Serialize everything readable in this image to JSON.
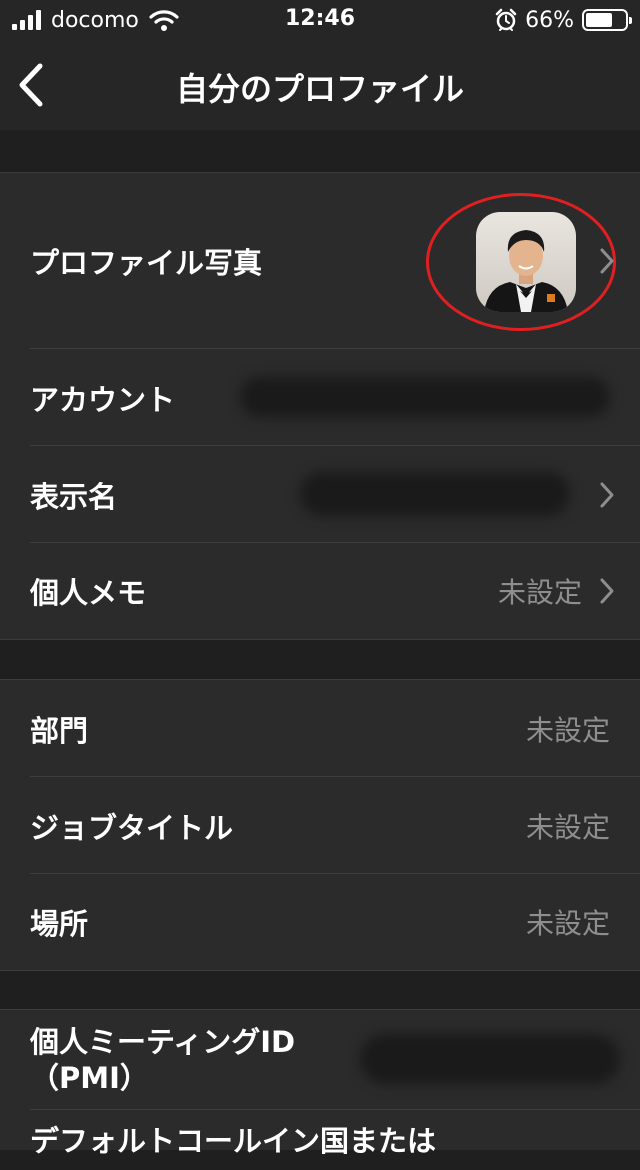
{
  "status_bar": {
    "carrier": "docomo",
    "time": "12:46",
    "battery_percent": "66%",
    "battery_level": 0.66,
    "icons": [
      "signal-icon",
      "wifi-icon",
      "alarm-icon",
      "battery-icon"
    ]
  },
  "header": {
    "title": "自分のプロファイル",
    "back_icon": "chevron-left-icon"
  },
  "sections": {
    "profile": {
      "photo_label": "プロファイル写真",
      "account_label": "アカウント",
      "display_name_label": "表示名",
      "memo_label": "個人メモ",
      "memo_value": "未設定"
    },
    "work": {
      "department_label": "部門",
      "department_value": "未設定",
      "job_title_label": "ジョブタイトル",
      "job_title_value": "未設定",
      "location_label": "場所",
      "location_value": "未設定"
    },
    "meeting": {
      "pmi_label_line1": "個人ミーティングID",
      "pmi_label_line2": "（PMI）",
      "default_call_label": "デフォルトコールイン国または"
    }
  },
  "colors": {
    "background": "#1f1f1f",
    "cell": "#2b2b2b",
    "header": "#262626",
    "secondary_text": "#8e8e8e",
    "highlight_circle": "#e02020"
  }
}
